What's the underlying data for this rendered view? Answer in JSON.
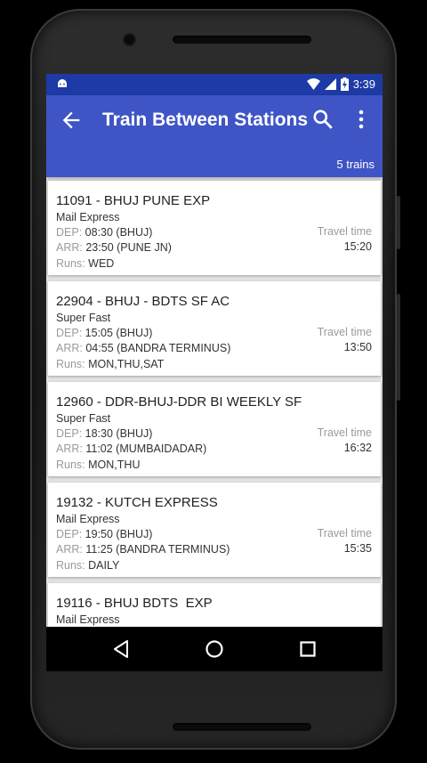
{
  "status_bar": {
    "time": "3:39",
    "icons": [
      "android-icon",
      "wifi-icon",
      "signal-icon",
      "battery-charging-icon"
    ]
  },
  "app_bar": {
    "title": "Train Between Stations",
    "count": "5 trains",
    "icons": [
      "back-arrow-icon",
      "search-icon",
      "more-vert-icon"
    ]
  },
  "labels": {
    "dep": "DEP:",
    "arr": "ARR:",
    "runs": "Runs:",
    "travel_time": "Travel time"
  },
  "trains": [
    {
      "name": "11091 - BHUJ PUNE EXP",
      "type": "Mail Express",
      "dep": "08:30 (BHUJ)",
      "arr": "23:50 (PUNE JN)",
      "runs": "WED",
      "travel_time": "15:20"
    },
    {
      "name": "22904 - BHUJ - BDTS SF AC",
      "type": "Super Fast",
      "dep": "15:05 (BHUJ)",
      "arr": "04:55 (BANDRA TERMINUS)",
      "runs": "MON,THU,SAT",
      "travel_time": "13:50"
    },
    {
      "name": "12960 - DDR-BHUJ-DDR BI WEEKLY SF",
      "type": "Super Fast",
      "dep": "18:30 (BHUJ)",
      "arr": "11:02 (MUMBAIDADAR)",
      "runs": "MON,THU",
      "travel_time": "16:32"
    },
    {
      "name": "19132 - KUTCH EXPRESS",
      "type": "Mail Express",
      "dep": "19:50 (BHUJ)",
      "arr": "11:25 (BANDRA TERMINUS)",
      "runs": "DAILY",
      "travel_time": "15:35"
    },
    {
      "name": "19116 - BHUJ BDTS  EXP",
      "type": "Mail Express"
    }
  ],
  "nav_bar": {
    "icons": [
      "back-triangle-icon",
      "home-circle-icon",
      "recents-square-icon"
    ]
  }
}
